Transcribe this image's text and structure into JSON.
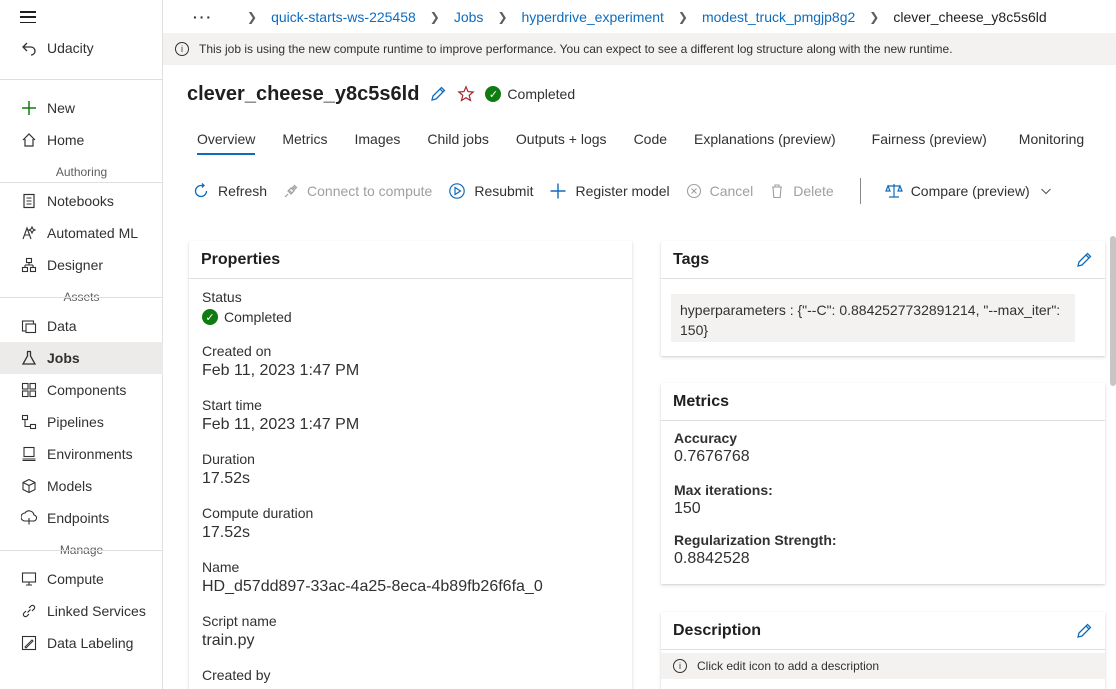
{
  "sidebar": {
    "workspace": "Udacity",
    "new_label": "New",
    "home_label": "Home",
    "authoring_section": "Authoring",
    "authoring_items": [
      "Notebooks",
      "Automated ML",
      "Designer"
    ],
    "assets_section": "Assets",
    "assets_items": [
      "Data",
      "Jobs",
      "Components",
      "Pipelines",
      "Environments",
      "Models",
      "Endpoints"
    ],
    "manage_section": "Manage",
    "manage_items": [
      "Compute",
      "Linked Services",
      "Data Labeling"
    ]
  },
  "breadcrumb": {
    "ellipsis": "···",
    "items": [
      "quick-starts-ws-225458",
      "Jobs",
      "hyperdrive_experiment",
      "modest_truck_pmgjp8g2"
    ],
    "current": "clever_cheese_y8c5s6ld"
  },
  "infobar": {
    "text": "This job is using the new compute runtime to improve performance. You can expect to see a different log structure along with the new runtime."
  },
  "header": {
    "title": "clever_cheese_y8c5s6ld",
    "status": "Completed"
  },
  "tabs": [
    "Overview",
    "Metrics",
    "Images",
    "Child jobs",
    "Outputs + logs",
    "Code",
    "Explanations (preview)",
    "Fairness (preview)",
    "Monitoring"
  ],
  "toolbar": {
    "refresh": "Refresh",
    "connect": "Connect to compute",
    "resubmit": "Resubmit",
    "register": "Register model",
    "cancel": "Cancel",
    "delete": "Delete",
    "compare": "Compare (preview)"
  },
  "properties": {
    "title": "Properties",
    "status_label": "Status",
    "status_value": "Completed",
    "created_on_label": "Created on",
    "created_on_value": "Feb 11, 2023 1:47 PM",
    "start_time_label": "Start time",
    "start_time_value": "Feb 11, 2023 1:47 PM",
    "duration_label": "Duration",
    "duration_value": "17.52s",
    "compute_duration_label": "Compute duration",
    "compute_duration_value": "17.52s",
    "name_label": "Name",
    "name_value": "HD_d57dd897-33ac-4a25-8eca-4b89fb26f6fa_0",
    "script_label": "Script name",
    "script_value": "train.py",
    "created_by_label": "Created by"
  },
  "tags": {
    "title": "Tags",
    "chip": "hyperparameters : {\"--C\": 0.8842527732891214, \"--max_iter\": 150}"
  },
  "metrics": {
    "title": "Metrics",
    "accuracy_label": "Accuracy",
    "accuracy_value": "0.7676768",
    "max_iter_label": "Max iterations:",
    "max_iter_value": "150",
    "reg_label": "Regularization Strength:",
    "reg_value": "0.8842528"
  },
  "description": {
    "title": "Description",
    "note": "Click edit icon to add a description"
  },
  "colors": {
    "accent": "#0f6cbd",
    "success": "#107c10"
  }
}
